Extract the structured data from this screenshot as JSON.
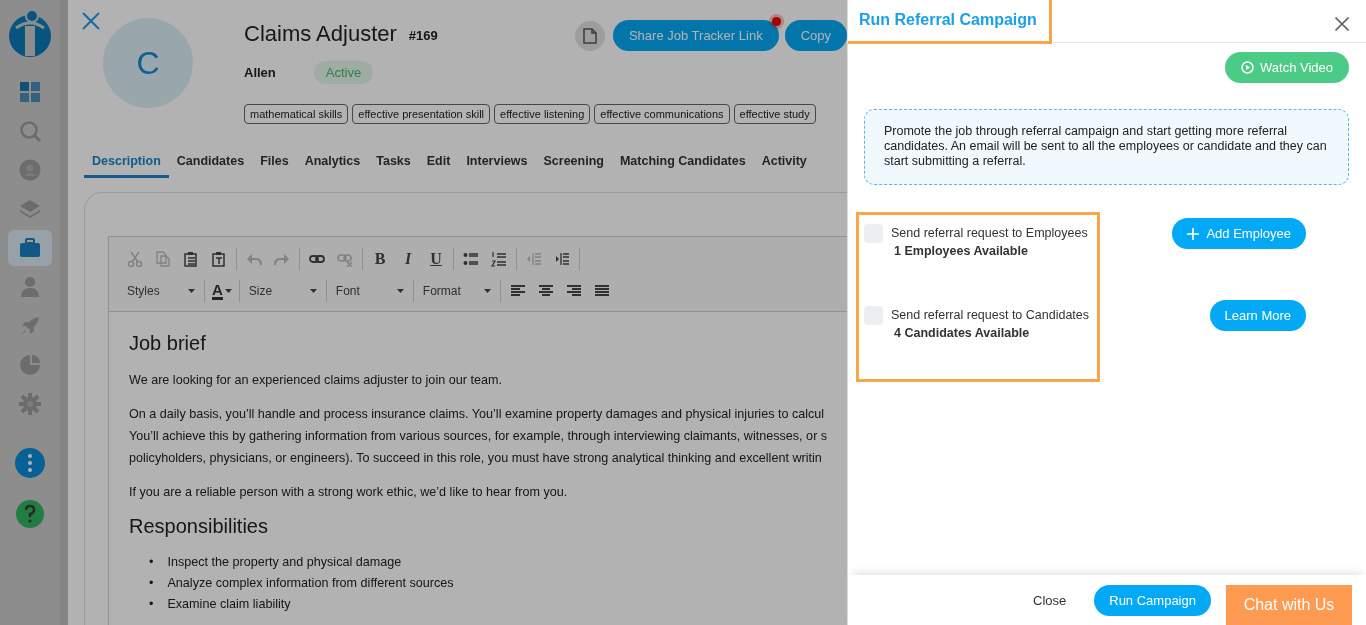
{
  "sidebar": {
    "items": [
      {
        "kind": "dashboard",
        "selected": false
      },
      {
        "kind": "search",
        "selected": false
      },
      {
        "kind": "user",
        "selected": false
      },
      {
        "kind": "layers",
        "selected": false
      },
      {
        "kind": "briefcase",
        "selected": true
      },
      {
        "kind": "person",
        "selected": false
      },
      {
        "kind": "rocket",
        "selected": false
      },
      {
        "kind": "pie",
        "selected": false
      },
      {
        "kind": "gear",
        "selected": false
      },
      {
        "kind": "more",
        "selected": false
      },
      {
        "kind": "help",
        "selected": false
      }
    ]
  },
  "job": {
    "avatar_letter": "C",
    "title": "Claims Adjuster",
    "number": "#169",
    "owner": "Allen",
    "status": "Active",
    "skills": [
      "mathematical skills",
      "effective presentation skill",
      "effective listening",
      "effective communications",
      "effective study"
    ],
    "actions": [
      {
        "label": "Share Job Tracker Link",
        "notification": true
      },
      {
        "label": "Copy",
        "notification": false
      }
    ]
  },
  "tabs": [
    {
      "label": "Description",
      "selected": true
    },
    {
      "label": "Candidates",
      "selected": false
    },
    {
      "label": "Files",
      "selected": false
    },
    {
      "label": "Analytics",
      "selected": false
    },
    {
      "label": "Tasks",
      "selected": false
    },
    {
      "label": "Edit",
      "selected": false
    },
    {
      "label": "Interviews",
      "selected": false
    },
    {
      "label": "Screening",
      "selected": false
    },
    {
      "label": "Matching Candidates",
      "selected": false
    },
    {
      "label": "Activity",
      "selected": false
    }
  ],
  "editor": {
    "toolbar_rows": [
      [
        {
          "kind": "cut",
          "disabled": true
        },
        {
          "kind": "copy",
          "disabled": true
        },
        {
          "kind": "paste",
          "disabled": false
        },
        {
          "kind": "paste-text",
          "disabled": false
        },
        {
          "kind": "separator"
        },
        {
          "kind": "undo",
          "disabled": true
        },
        {
          "kind": "redo",
          "disabled": true
        },
        {
          "kind": "separator"
        },
        {
          "kind": "link",
          "disabled": false
        },
        {
          "kind": "unlink",
          "disabled": true
        },
        {
          "kind": "separator"
        },
        {
          "kind": "bold",
          "label": "B",
          "disabled": false
        },
        {
          "kind": "italic",
          "label": "I",
          "disabled": false
        },
        {
          "kind": "underline",
          "label": "U",
          "disabled": false
        },
        {
          "kind": "separator"
        },
        {
          "kind": "bullet-list",
          "disabled": false
        },
        {
          "kind": "numbered-list",
          "disabled": false
        },
        {
          "kind": "separator"
        },
        {
          "kind": "outdent",
          "disabled": true
        },
        {
          "kind": "indent",
          "disabled": false
        },
        {
          "kind": "separator"
        }
      ],
      [
        {
          "kind": "dropdown",
          "label": "Styles"
        },
        {
          "kind": "separator"
        },
        {
          "kind": "color",
          "label": "A"
        },
        {
          "kind": "separator"
        },
        {
          "kind": "dropdown",
          "label": "Size"
        },
        {
          "kind": "separator"
        },
        {
          "kind": "dropdown",
          "label": "Font"
        },
        {
          "kind": "separator"
        },
        {
          "kind": "dropdown",
          "label": "Format"
        },
        {
          "kind": "separator"
        },
        {
          "kind": "align-left",
          "disabled": false
        },
        {
          "kind": "align-center",
          "disabled": false
        },
        {
          "kind": "align-right",
          "disabled": false
        },
        {
          "kind": "align-justify",
          "disabled": false
        }
      ]
    ],
    "content": [
      {
        "kind": "heading",
        "text": "Job brief"
      },
      {
        "kind": "paragraph",
        "lines": [
          "We are looking for an experienced claims adjuster to join our team."
        ]
      },
      {
        "kind": "paragraph",
        "lines": [
          "On a daily basis, you’ll handle and process insurance claims. You’ll examine property damages and physical injuries to calcul",
          "You’ll achieve this by gathering information from various sources, for example, through interviewing claimants, witnesses, or s",
          "policyholders, physicians, or engineers). To succeed in this role, you must have strong analytical thinking and excellent writin"
        ]
      },
      {
        "kind": "paragraph",
        "lines": [
          "If you are a reliable person with a strong work ethic, we’d like to hear from you."
        ]
      },
      {
        "kind": "heading",
        "text": "Responsibilities"
      },
      {
        "kind": "list",
        "items": [
          {
            "bullet": "•",
            "text": "Inspect the property and physical damage"
          },
          {
            "bullet": "•",
            "text": "Analyze complex information from different sources"
          },
          {
            "bullet": "•",
            "text": "Examine claim liability"
          }
        ]
      }
    ]
  },
  "drawer": {
    "title": "Run Referral Campaign",
    "watch_video": "Watch Video",
    "info": "Promote the job through referral campaign and start getting more referral candidates. An email will be sent to all the employees or candidate and they can start submitting a referral.",
    "options": [
      {
        "label": "Send referral request to Employees",
        "count": "1 Employees Available",
        "checked": false,
        "button": {
          "label": "Add Employee",
          "kind": "add"
        }
      },
      {
        "label": "Send referral request to Candidates",
        "count": "4 Candidates Available",
        "checked": false,
        "button": {
          "label": "Learn More",
          "kind": "plain"
        }
      }
    ],
    "footer": {
      "close": "Close",
      "primary": "Run Campaign"
    }
  },
  "chat": {
    "label": "Chat with Us"
  }
}
